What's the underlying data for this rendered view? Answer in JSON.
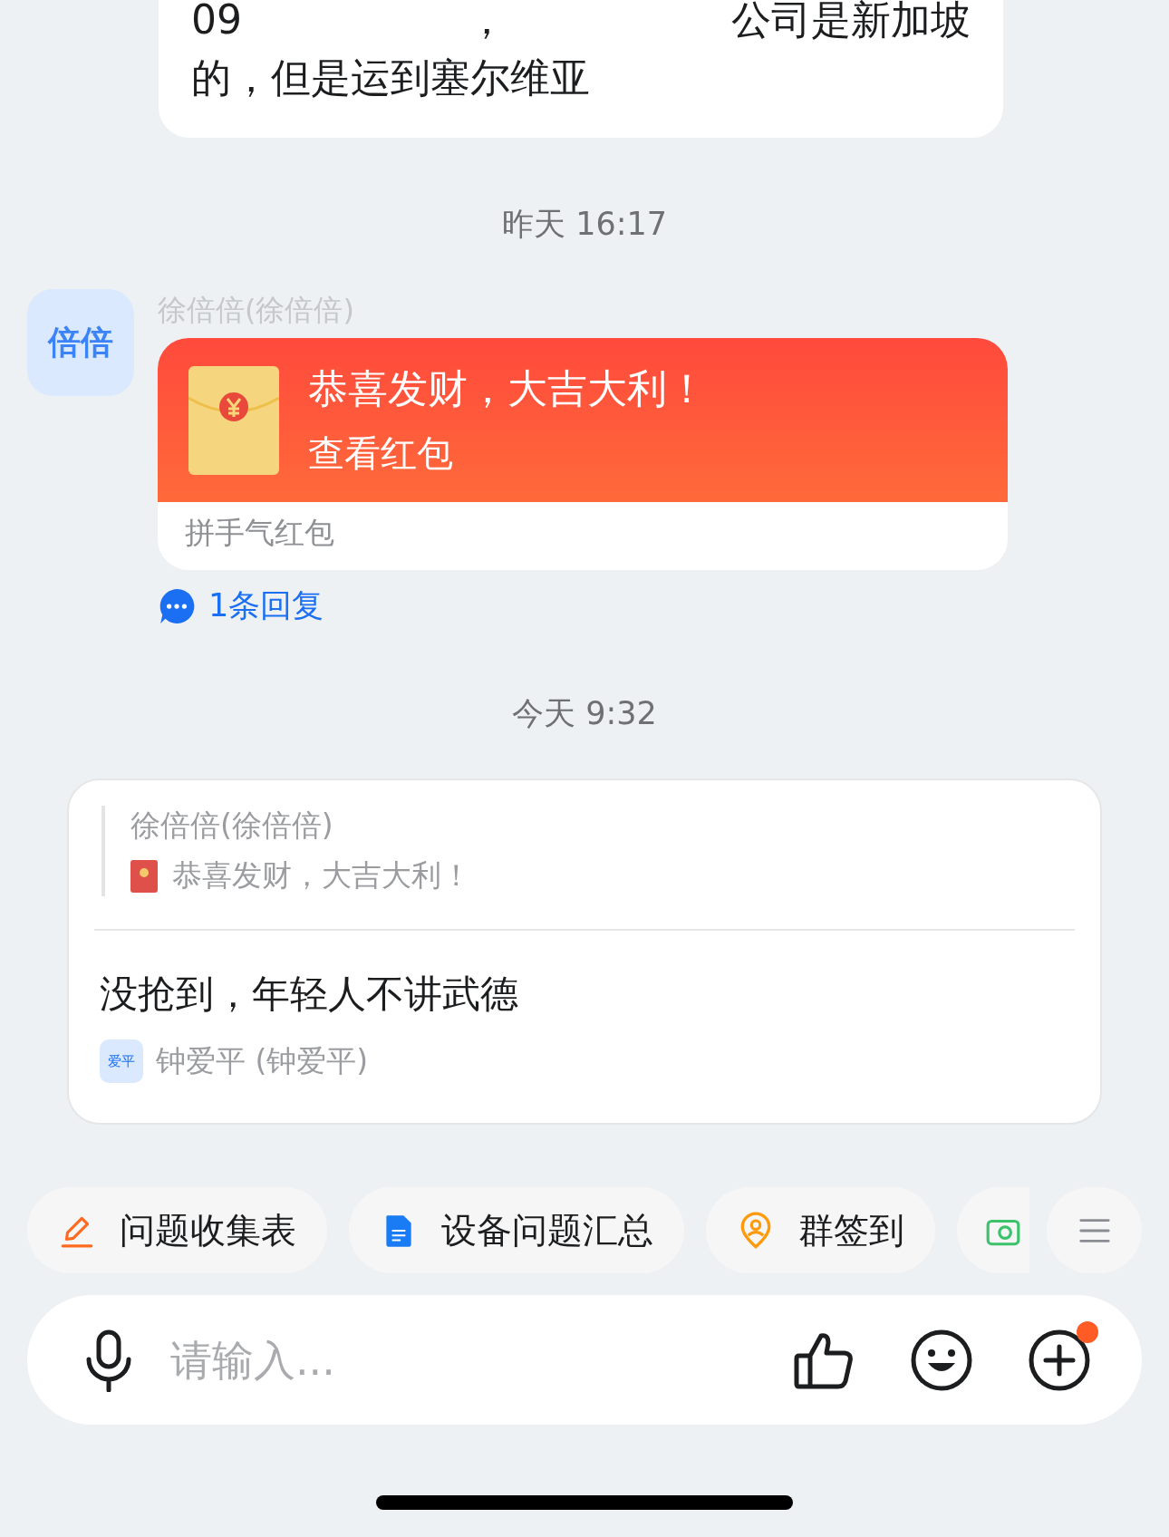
{
  "messages": [
    {
      "kind": "text",
      "lines": [
        [
          "09",
          "，",
          "公司是新加坡"
        ],
        [
          "的，但是运到塞尔维亚"
        ]
      ]
    },
    {
      "kind": "time",
      "text": "昨天 16:17"
    },
    {
      "kind": "red_packet",
      "avatar": "倍倍",
      "sender": "徐倍倍(徐倍倍)",
      "title": "恭喜发财，大吉大利！",
      "action": "查看红包",
      "type_label": "拼手气红包",
      "replies": "1条回复"
    },
    {
      "kind": "time",
      "text": "今天 9:32"
    },
    {
      "kind": "reply",
      "quote_sender": "徐倍倍(徐倍倍)",
      "quote_text": "恭喜发财，大吉大利！",
      "text": "没抢到，年轻人不讲武德",
      "avatar": "爱平",
      "sender": "钟爱平 (钟爱平)"
    }
  ],
  "shortcuts": [
    {
      "label": "问题收集表"
    },
    {
      "label": "设备问题汇总"
    },
    {
      "label": "群签到"
    }
  ],
  "input": {
    "placeholder": "请输入...",
    "plus_badge": true
  }
}
